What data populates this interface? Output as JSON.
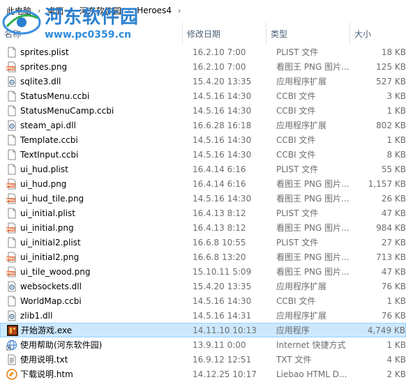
{
  "breadcrumb": [
    "此电脑",
    "桌面",
    "河东软件园",
    "Heroes4"
  ],
  "watermark": {
    "title": "河东软件园",
    "url": "www.pc0359.cn"
  },
  "columns": {
    "name": "名称",
    "date": "修改日期",
    "type": "类型",
    "size": "大小"
  },
  "files": [
    {
      "name": "sprites.plist",
      "date": "16.2.10 7:00",
      "type": "PLIST 文件",
      "size": "18 KB",
      "icon": "document-icon"
    },
    {
      "name": "sprites.png",
      "date": "16.2.10 7:00",
      "type": "看图王 PNG 图片...",
      "size": "125 KB",
      "icon": "png-icon"
    },
    {
      "name": "sqlite3.dll",
      "date": "15.4.20 13:35",
      "type": "应用程序扩展",
      "size": "527 KB",
      "icon": "dll-icon"
    },
    {
      "name": "StatusMenu.ccbi",
      "date": "14.5.16 14:30",
      "type": "CCBI 文件",
      "size": "3 KB",
      "icon": "document-icon"
    },
    {
      "name": "StatusMenuCamp.ccbi",
      "date": "14.5.16 14:30",
      "type": "CCBI 文件",
      "size": "1 KB",
      "icon": "document-icon"
    },
    {
      "name": "steam_api.dll",
      "date": "16.6.28 16:18",
      "type": "应用程序扩展",
      "size": "802 KB",
      "icon": "dll-icon"
    },
    {
      "name": "Template.ccbi",
      "date": "14.5.16 14:30",
      "type": "CCBI 文件",
      "size": "1 KB",
      "icon": "document-icon"
    },
    {
      "name": "TextInput.ccbi",
      "date": "14.5.16 14:30",
      "type": "CCBI 文件",
      "size": "8 KB",
      "icon": "document-icon"
    },
    {
      "name": "ui_hud.plist",
      "date": "16.4.14 6:16",
      "type": "PLIST 文件",
      "size": "55 KB",
      "icon": "document-icon"
    },
    {
      "name": "ui_hud.png",
      "date": "16.4.14 6:16",
      "type": "看图王 PNG 图片...",
      "size": "1,157 KB",
      "icon": "png-icon"
    },
    {
      "name": "ui_hud_tile.png",
      "date": "14.5.16 14:30",
      "type": "看图王 PNG 图片...",
      "size": "26 KB",
      "icon": "png-icon"
    },
    {
      "name": "ui_initial.plist",
      "date": "16.4.13 8:12",
      "type": "PLIST 文件",
      "size": "47 KB",
      "icon": "document-icon"
    },
    {
      "name": "ui_initial.png",
      "date": "16.4.13 8:12",
      "type": "看图王 PNG 图片...",
      "size": "984 KB",
      "icon": "png-icon"
    },
    {
      "name": "ui_initial2.plist",
      "date": "16.6.8 10:55",
      "type": "PLIST 文件",
      "size": "27 KB",
      "icon": "document-icon"
    },
    {
      "name": "ui_initial2.png",
      "date": "16.6.8 13:20",
      "type": "看图王 PNG 图片...",
      "size": "713 KB",
      "icon": "png-icon"
    },
    {
      "name": "ui_tile_wood.png",
      "date": "15.10.11 5:09",
      "type": "看图王 PNG 图片...",
      "size": "47 KB",
      "icon": "png-icon"
    },
    {
      "name": "websockets.dll",
      "date": "15.4.20 13:35",
      "type": "应用程序扩展",
      "size": "76 KB",
      "icon": "dll-icon"
    },
    {
      "name": "WorldMap.ccbi",
      "date": "14.5.16 14:30",
      "type": "CCBI 文件",
      "size": "1 KB",
      "icon": "document-icon"
    },
    {
      "name": "zlib1.dll",
      "date": "14.5.16 14:31",
      "type": "应用程序扩展",
      "size": "76 KB",
      "icon": "dll-icon"
    },
    {
      "name": "开始游戏.exe",
      "date": "14.11.10 10:13",
      "type": "应用程序",
      "size": "4,749 KB",
      "icon": "game-exe-icon",
      "selected": true
    },
    {
      "name": "使用帮助(河东软件园)",
      "date": "13.9.11 0:00",
      "type": "Internet 快捷方式",
      "size": "1 KB",
      "icon": "internet-shortcut-icon"
    },
    {
      "name": "使用说明.txt",
      "date": "16.9.12 12:51",
      "type": "TXT 文件",
      "size": "4 KB",
      "icon": "text-file-icon"
    },
    {
      "name": "下载说明.htm",
      "date": "14.12.25 10:17",
      "type": "Liebao HTML D...",
      "size": "2 KB",
      "icon": "html-file-icon"
    }
  ],
  "colors": {
    "selection": "#cce8ff",
    "selection_border": "#99d1ff",
    "header_text": "#4c607a",
    "watermark": "#2a7fd0"
  }
}
